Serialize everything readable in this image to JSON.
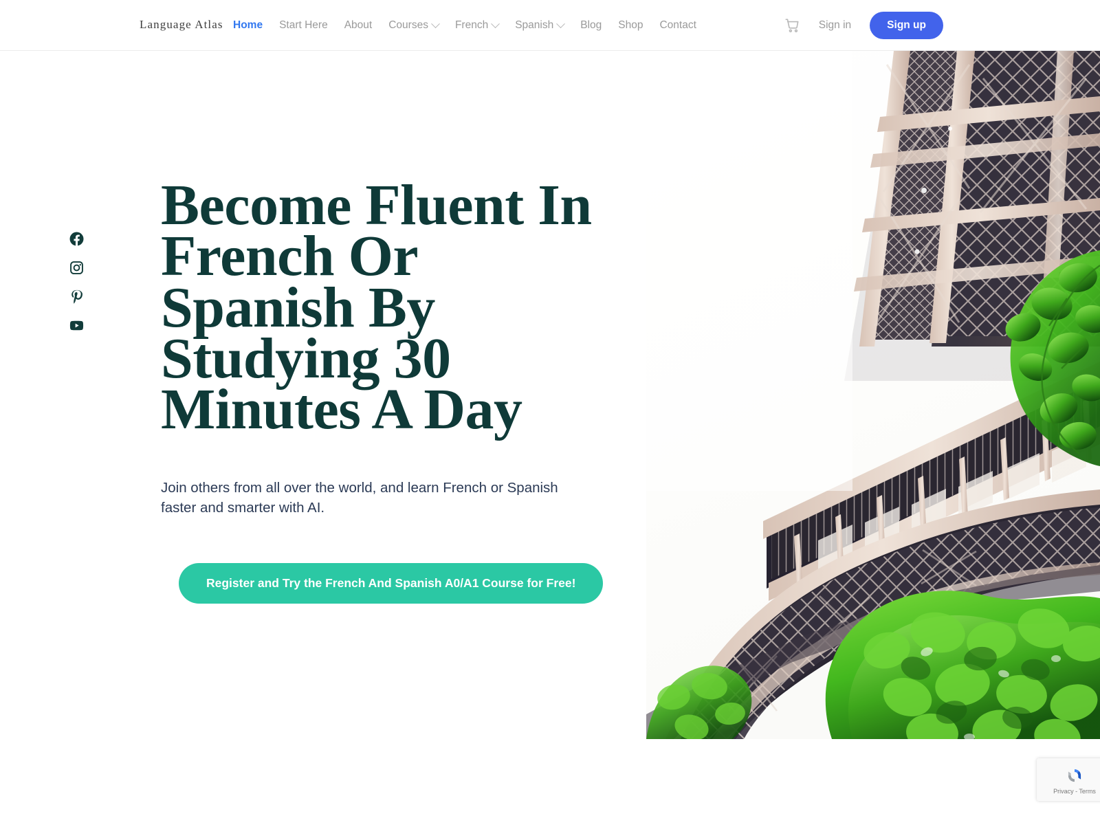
{
  "header": {
    "brand": "Language Atlas",
    "nav": [
      {
        "label": "Home",
        "active": true,
        "caret": false
      },
      {
        "label": "Start Here",
        "active": false,
        "caret": false
      },
      {
        "label": "About",
        "active": false,
        "caret": false
      },
      {
        "label": "Courses",
        "active": false,
        "caret": true
      },
      {
        "label": "French",
        "active": false,
        "caret": true
      },
      {
        "label": "Spanish",
        "active": false,
        "caret": true
      },
      {
        "label": "Blog",
        "active": false,
        "caret": false
      },
      {
        "label": "Shop",
        "active": false,
        "caret": false
      },
      {
        "label": "Contact",
        "active": false,
        "caret": false
      }
    ],
    "cart_icon": "shopping-cart-icon",
    "sign_in_label": "Sign in",
    "sign_up_label": "Sign up",
    "accent_color": "#4263eb",
    "nav_text_color": "#9a9a9a"
  },
  "social": [
    {
      "name": "facebook-icon",
      "label": "Facebook"
    },
    {
      "name": "instagram-icon",
      "label": "Instagram"
    },
    {
      "name": "pinterest-icon",
      "label": "Pinterest"
    },
    {
      "name": "youtube-icon",
      "label": "YouTube"
    }
  ],
  "hero": {
    "title": "Become Fluent In French Or Spanish By Studying 30 Minutes A Day",
    "title_lines": "Become Fluent In\nFrench Or\nSpanish By\nStudying 30\nMinutes A Day",
    "subtitle": "Join others from all over the world, and learn French or Spanish faster and smarter with AI.",
    "cta_label": "Register and Try the French And Spanish A0/A1 Course for Free!",
    "title_color": "#0f3a38",
    "subtitle_color": "#2b3a55",
    "cta_color": "#2bc8a4",
    "image_alt": "Eiffel Tower with green trees"
  },
  "recaptcha": {
    "text": "Privacy - Terms",
    "logo": "recaptcha-logo-icon"
  }
}
